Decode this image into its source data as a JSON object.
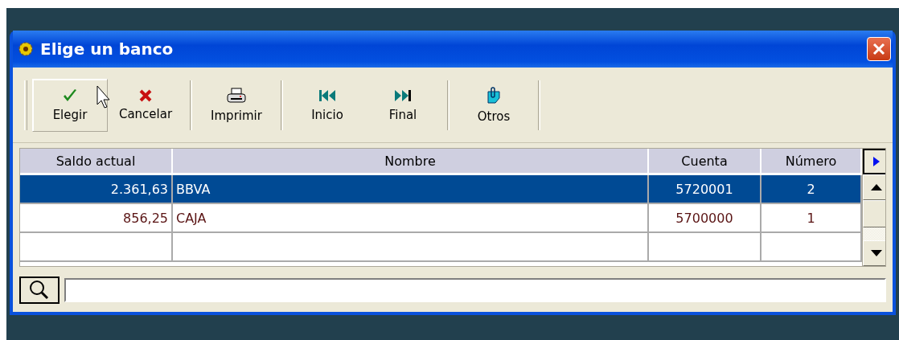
{
  "window": {
    "title": "Elige un banco"
  },
  "toolbar": {
    "groups": [
      [
        {
          "label": "Elegir",
          "kind": "check",
          "hover": true
        },
        {
          "label": "Cancelar",
          "kind": "cross",
          "hover": false
        }
      ],
      [
        {
          "label": "Imprimir",
          "kind": "printer",
          "hover": false
        }
      ],
      [
        {
          "label": "Inicio",
          "kind": "first",
          "hover": false
        },
        {
          "label": "Final",
          "kind": "last",
          "hover": false
        }
      ],
      [
        {
          "label": "Otros",
          "kind": "clip",
          "hover": false
        }
      ]
    ]
  },
  "table": {
    "columns": [
      {
        "label": "Saldo actual"
      },
      {
        "label": "Nombre"
      },
      {
        "label": "Cuenta"
      },
      {
        "label": "Número"
      }
    ],
    "rows": [
      {
        "cells": [
          "2.361,63",
          "BBVA",
          "5720001",
          "2"
        ],
        "selected": true
      },
      {
        "cells": [
          "856,25",
          "CAJA",
          "5700000",
          "1"
        ],
        "selected": false
      },
      {
        "cells": [],
        "selected": false
      }
    ]
  }
}
